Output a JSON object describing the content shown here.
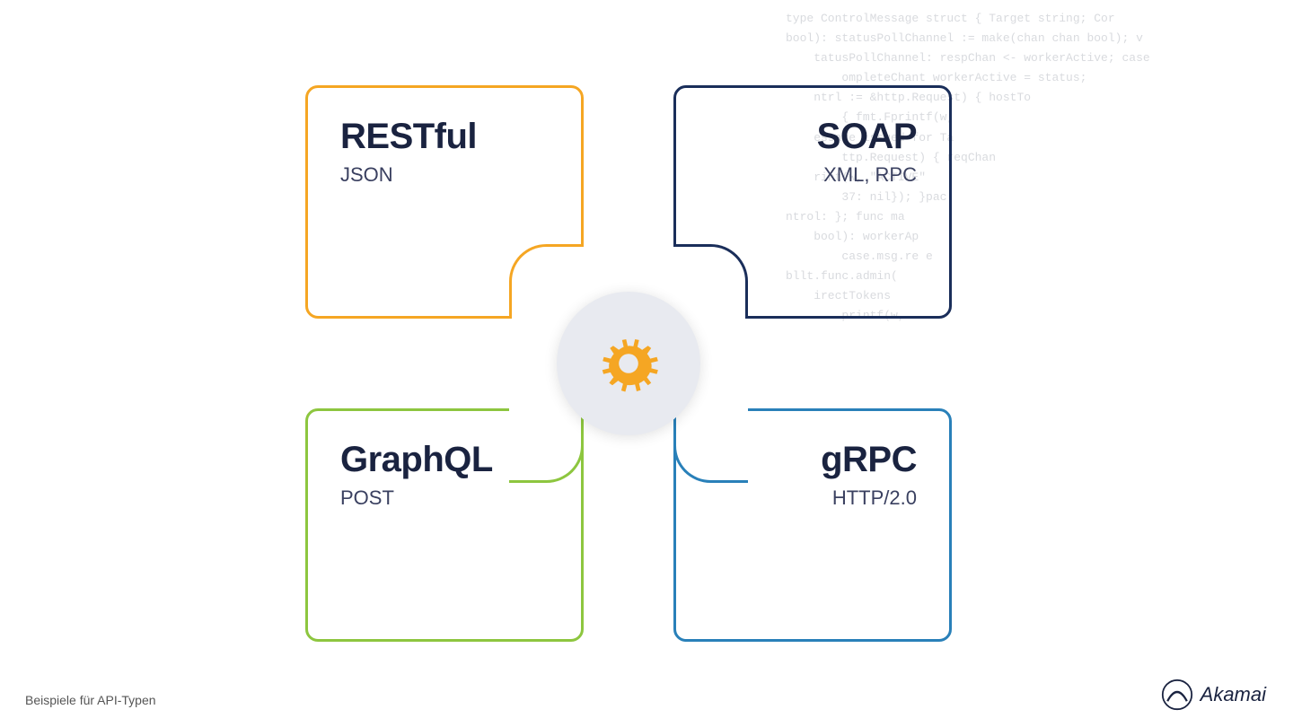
{
  "background_code": "type ControlMessage struct { Target string; Cor\nbool): statusPollChannel := make(chan chan bool); v\ntatusPollChannel: respChan <- workerActive; case\nompleteChant workerActive = status;\nntrl := &http.Request) { hostTo\n{ fmt.Fprintf(w,\nessage issued for Ta\nttp.Request) { reqChan\nrint(w, \"ACTIVE\"\n37: nil}); }pac\nntrol: }; func ma\nbool): workerAp\ncase.msg.re e\nbllt.func.admin(\nirectTokens\nprintf(w.",
  "quadrants": [
    {
      "id": "restful",
      "title": "RESTful",
      "subtitle": "JSON",
      "border_color": "#f5a623",
      "position": "top-left"
    },
    {
      "id": "soap",
      "title": "SOAP",
      "subtitle": "XML, RPC",
      "border_color": "#1a2e5a",
      "position": "top-right"
    },
    {
      "id": "graphql",
      "title": "GraphQL",
      "subtitle": "POST",
      "border_color": "#8dc63f",
      "position": "bottom-left"
    },
    {
      "id": "grpc",
      "title": "gRPC",
      "subtitle": "HTTP/2.0",
      "border_color": "#2980b9",
      "position": "bottom-right"
    }
  ],
  "center": {
    "icon": "gear"
  },
  "footer": {
    "caption": "Beispiele für API-Typen",
    "brand": "Akamai"
  }
}
